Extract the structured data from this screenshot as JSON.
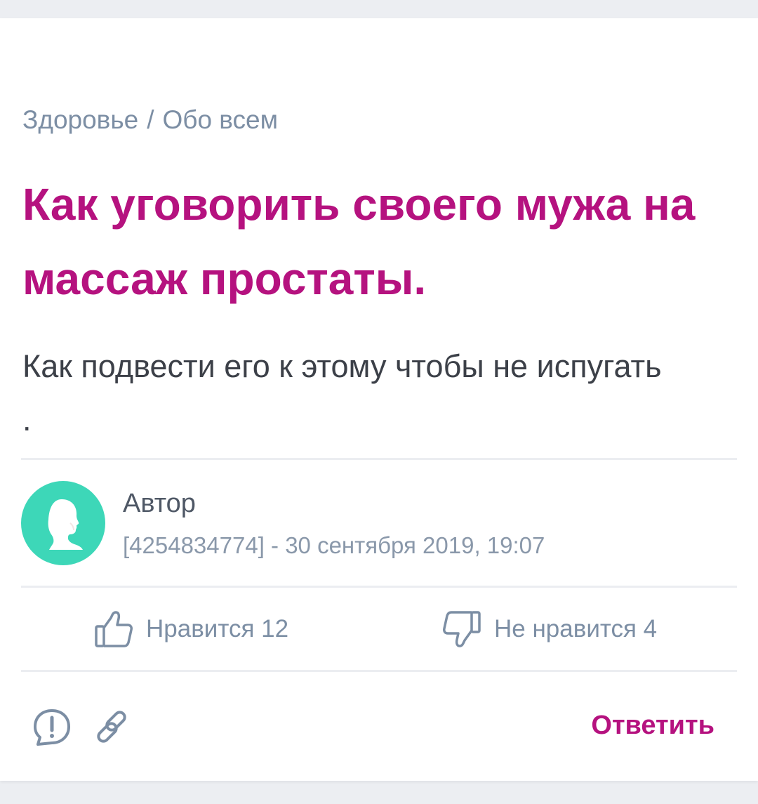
{
  "breadcrumb": {
    "category": "Здоровье",
    "separator": "/",
    "subcategory": "Обо всем"
  },
  "post": {
    "title": "Как уговорить своего мужа на массаж простаты.",
    "body": "Как подвести его к этому чтобы не испугать\n."
  },
  "author": {
    "name": "Автор",
    "meta": "[4254834774] - 30 сентября 2019, 19:07",
    "avatar_icon": "user-silhouette-icon",
    "avatar_color": "#3dd7b8"
  },
  "votes": {
    "like_label": "Нравится 12",
    "dislike_label": "Не нравится 4",
    "like_icon": "thumbs-up-icon",
    "dislike_icon": "thumbs-down-icon"
  },
  "actions": {
    "report_icon": "exclamation-bubble-icon",
    "link_icon": "chain-link-icon",
    "reply_label": "Ответить"
  },
  "colors": {
    "accent": "#b5127f",
    "muted": "#7c8ea4",
    "text": "#3c4048"
  }
}
